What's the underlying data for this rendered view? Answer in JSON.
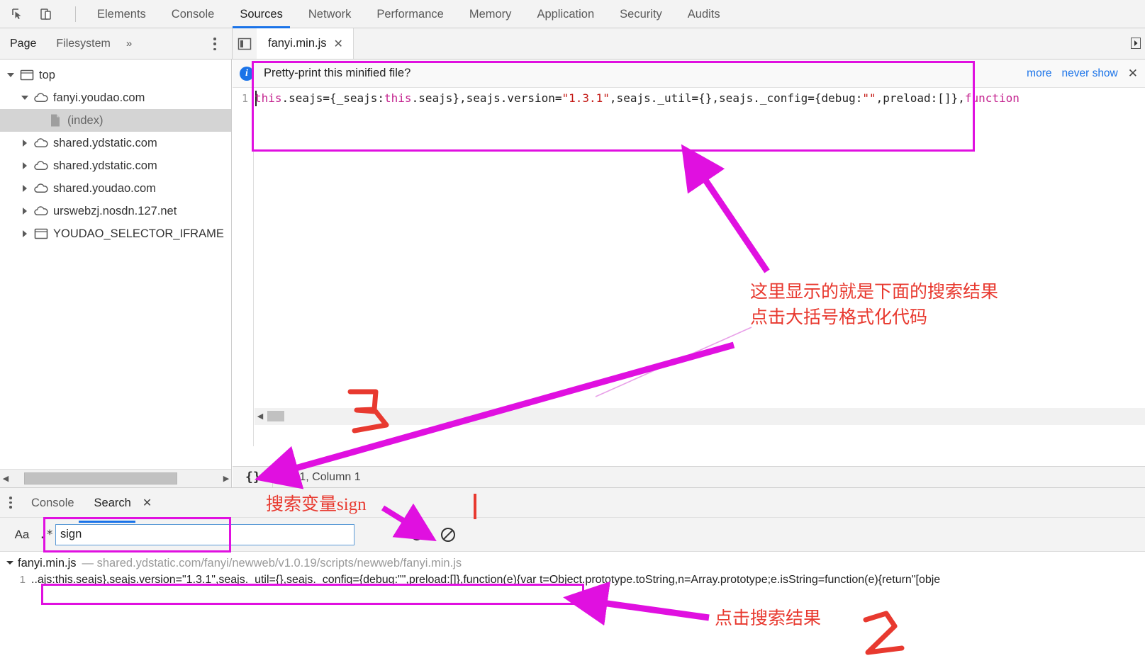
{
  "toolbar": {
    "icons": [
      {
        "name": "inspect-element-icon"
      },
      {
        "name": "device-toolbar-icon"
      }
    ],
    "tabs": [
      {
        "label": "Elements",
        "active": false
      },
      {
        "label": "Console",
        "active": false
      },
      {
        "label": "Sources",
        "active": true
      },
      {
        "label": "Network",
        "active": false
      },
      {
        "label": "Performance",
        "active": false
      },
      {
        "label": "Memory",
        "active": false
      },
      {
        "label": "Application",
        "active": false
      },
      {
        "label": "Security",
        "active": false
      },
      {
        "label": "Audits",
        "active": false
      }
    ],
    "accent_color": "#1a73e8"
  },
  "navigator": {
    "pane_tabs": [
      {
        "label": "Page",
        "active": true
      },
      {
        "label": "Filesystem",
        "active": false
      }
    ],
    "more_chevrons": "»",
    "tree": [
      {
        "label": "top",
        "icon": "frame-icon",
        "twisty": "down",
        "indent": 0,
        "selected": false
      },
      {
        "label": "fanyi.youdao.com",
        "icon": "cloud-icon",
        "twisty": "down",
        "indent": 1,
        "selected": false
      },
      {
        "label": "(index)",
        "icon": "document-icon",
        "twisty": "none",
        "indent": 2,
        "selected": true
      },
      {
        "label": "shared.ydstatic.com",
        "icon": "cloud-icon",
        "twisty": "right",
        "indent": 1,
        "selected": false
      },
      {
        "label": "shared.ydstatic.com",
        "icon": "cloud-icon",
        "twisty": "right",
        "indent": 1,
        "selected": false
      },
      {
        "label": "shared.youdao.com",
        "icon": "cloud-icon",
        "twisty": "right",
        "indent": 1,
        "selected": false
      },
      {
        "label": "urswebzj.nosdn.127.net",
        "icon": "cloud-icon",
        "twisty": "right",
        "indent": 1,
        "selected": false
      },
      {
        "label": "YOUDAO_SELECTOR_IFRAME",
        "icon": "frame-icon",
        "twisty": "right",
        "indent": 1,
        "selected": false
      }
    ]
  },
  "editor": {
    "file_tab": {
      "label": "fanyi.min.js",
      "close": "✕"
    },
    "infobar": {
      "message": "Pretty-print this minified file?",
      "more_label": "more",
      "never_show_label": "never show",
      "close": "✕"
    },
    "line_number": "1",
    "code_tokens": [
      {
        "t": "this",
        "c": "kw"
      },
      {
        "t": ".seajs={_seajs:",
        "c": "plain"
      },
      {
        "t": "this",
        "c": "kw"
      },
      {
        "t": ".seajs},seajs.version=",
        "c": "plain"
      },
      {
        "t": "\"1.3.1\"",
        "c": "str"
      },
      {
        "t": ",seajs._util={},seajs._config={debug:",
        "c": "plain"
      },
      {
        "t": "\"\"",
        "c": "str"
      },
      {
        "t": ",preload:[]},",
        "c": "plain"
      },
      {
        "t": "function",
        "c": "kw"
      }
    ],
    "status": {
      "format_button": "{}",
      "position": "Line 1, Column 1"
    }
  },
  "drawer": {
    "tabs": [
      {
        "label": "Console",
        "active": false
      },
      {
        "label": "Search",
        "active": true
      }
    ],
    "tab_close": "✕",
    "match_case_label": "Aa",
    "regex_label": ".*",
    "search_value": "sign",
    "refresh_icon": "refresh-icon",
    "clear_icon": "clear-icon",
    "results": {
      "file_name": "fanyi.min.js",
      "separator": "—",
      "file_url": "shared.ydstatic.com/fanyi/newweb/v1.0.19/scripts/newweb/fanyi.min.js",
      "line_number": "1",
      "ellipsis": "..",
      "line_code": "ajs:this.seajs},seajs.version=\"1.3.1\",seajs._util={},seajs._config={debug:\"\",preload:[]},function(e){var t=Object.prototype.toString,n=Array.prototype;e.isString=function(e){return\"[obje"
    }
  },
  "annotations": {
    "color_box": "#e010e0",
    "color_text": "#e8392f",
    "note_editor_line1": "这里显示的就是下面的搜索结果",
    "note_editor_line2": "点击大括号格式化代码",
    "note_search_var": "搜索变量sign",
    "note_click_result": "点击搜索结果",
    "step_three": "3",
    "step_two": "2"
  }
}
